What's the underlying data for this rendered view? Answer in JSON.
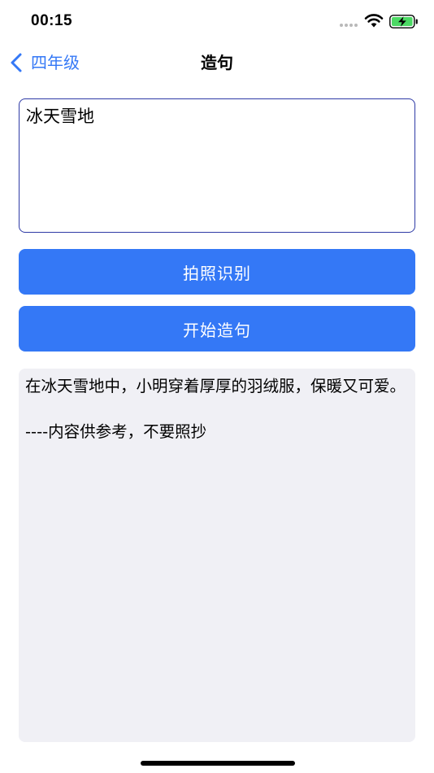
{
  "status_bar": {
    "time": "00:15",
    "accent_color": "#4cd964"
  },
  "nav": {
    "back_label": "四年级",
    "title": "造句",
    "accent_color": "#3478f6"
  },
  "input": {
    "value": "冰天雪地"
  },
  "buttons": {
    "photo_label": "拍照识别",
    "start_label": "开始造句",
    "color": "#3478f6"
  },
  "result": {
    "text": "在冰天雪地中，小明穿着厚厚的羽绒服，保暖又可爱。",
    "note": "----内容供参考，不要照抄"
  }
}
